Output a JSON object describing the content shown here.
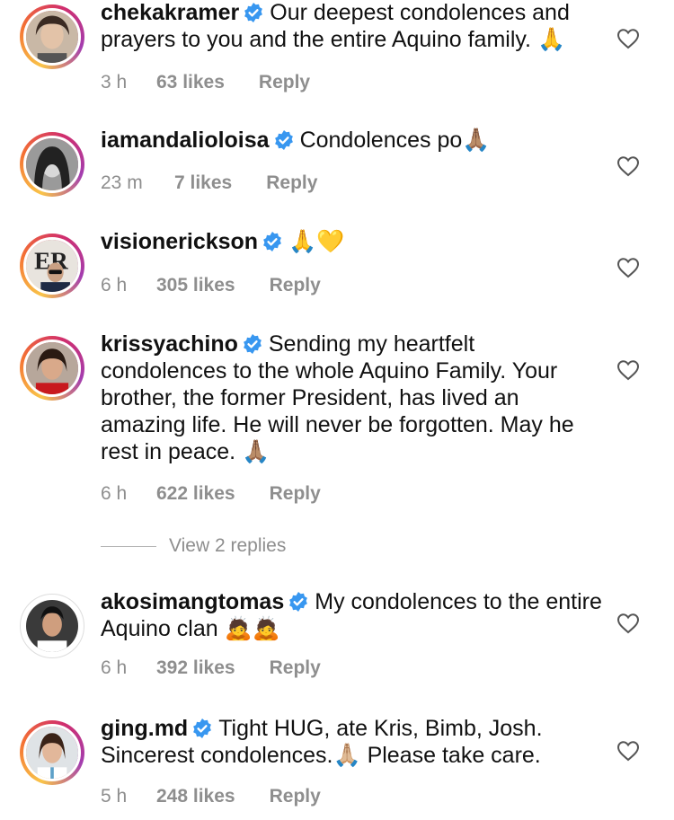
{
  "comments": [
    {
      "username": "chekakramer",
      "text": "Our deepest condolences and prayers to you and the entire Aquino family.",
      "emoji": "🙏",
      "time": "3 h",
      "likes": "63 likes",
      "reply": "Reply"
    },
    {
      "username": "iamandalioloisa",
      "text": "Condolences po",
      "emoji": "🙏🏽",
      "time": "23 m",
      "likes": "7 likes",
      "reply": "Reply"
    },
    {
      "username": "visionerickson",
      "text": "",
      "emoji": "🙏💛",
      "time": "6 h",
      "likes": "305 likes",
      "reply": "Reply"
    },
    {
      "username": "krissyachino",
      "text": "Sending my heartfelt condolences to the whole Aquino Family. Your brother, the former President, has lived an amazing life. He will never be forgotten. May he rest in peace.",
      "emoji": "🙏🏽",
      "time": "6 h",
      "likes": "622 likes",
      "reply": "Reply",
      "view_replies": "View 2 replies"
    },
    {
      "username": "akosimangtomas",
      "text": "My condolences to the entire Aquino clan",
      "emoji": "🙇🙇",
      "time": "6 h",
      "likes": "392 likes",
      "reply": "Reply"
    },
    {
      "username": "ging.md",
      "text": "Tight HUG, ate Kris, Bimb, Josh. Sincerest condolences.",
      "text2": "Please take care.",
      "emoji": "🙏🏼",
      "time": "5 h",
      "likes": "248 likes",
      "reply": "Reply"
    }
  ],
  "icons": {
    "verified": "verified-badge-icon",
    "like": "heart-outline-icon"
  },
  "colors": {
    "verified_blue": "#3897f0",
    "meta_gray": "#8e8e8e"
  }
}
